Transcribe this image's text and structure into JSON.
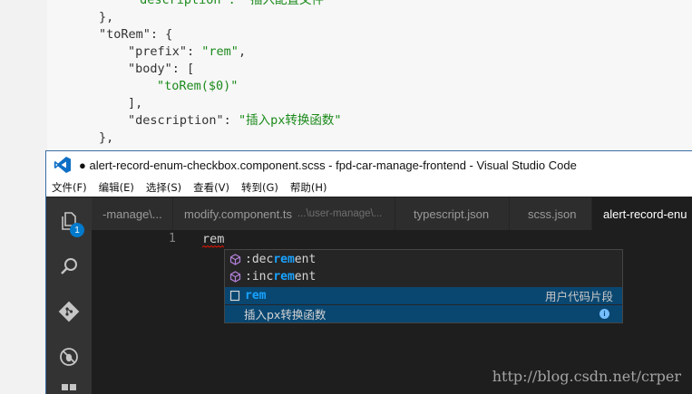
{
  "background_code": {
    "line0": "\"description\": \"插入配置文件\"",
    "line1": "},",
    "line2_key": "\"toRem\"",
    "line2_rest": ": {",
    "line3_key": "\"prefix\"",
    "line3_val": "\"rem\"",
    "line4_key": "\"body\"",
    "line4_rest": ": [",
    "line5": "\"toRem($0)\"",
    "line6": "],",
    "line7_key": "\"description\"",
    "line7_val": "\"插入px转换函数\"",
    "line8": "},"
  },
  "window": {
    "title": "● alert-record-enum-checkbox.component.scss - fpd-car-manage-frontend - Visual Studio Code"
  },
  "menu": [
    "文件(F)",
    "编辑(E)",
    "选择(S)",
    "查看(V)",
    "转到(G)",
    "帮助(H)"
  ],
  "activity": {
    "explorer_badge": "1"
  },
  "tabs": [
    {
      "label": "-manage\\...",
      "desc": ""
    },
    {
      "label": "modify.component.ts",
      "desc": "...\\user-manage\\..."
    },
    {
      "label": "typescript.json",
      "desc": ""
    },
    {
      "label": "scss.json",
      "desc": ""
    },
    {
      "label": "alert-record-enu",
      "desc": ""
    }
  ],
  "editor": {
    "line_number": "1",
    "line_text": "rem"
  },
  "suggestions": [
    {
      "prefix": ":dec",
      "match": "rem",
      "suffix": "ent",
      "kind": ""
    },
    {
      "prefix": ":inc",
      "match": "rem",
      "suffix": "ent",
      "kind": ""
    },
    {
      "prefix": "",
      "match": "rem",
      "suffix": "",
      "kind": "用户代码片段"
    }
  ],
  "suggestion_detail": "插入px转换函数",
  "watermark": "http://blog.csdn.net/crper",
  "colors": {
    "vscode_blue": "#007acc",
    "selection": "#094771",
    "match_highlight": "#18a3ff",
    "json_string": "#1b8a1b"
  }
}
